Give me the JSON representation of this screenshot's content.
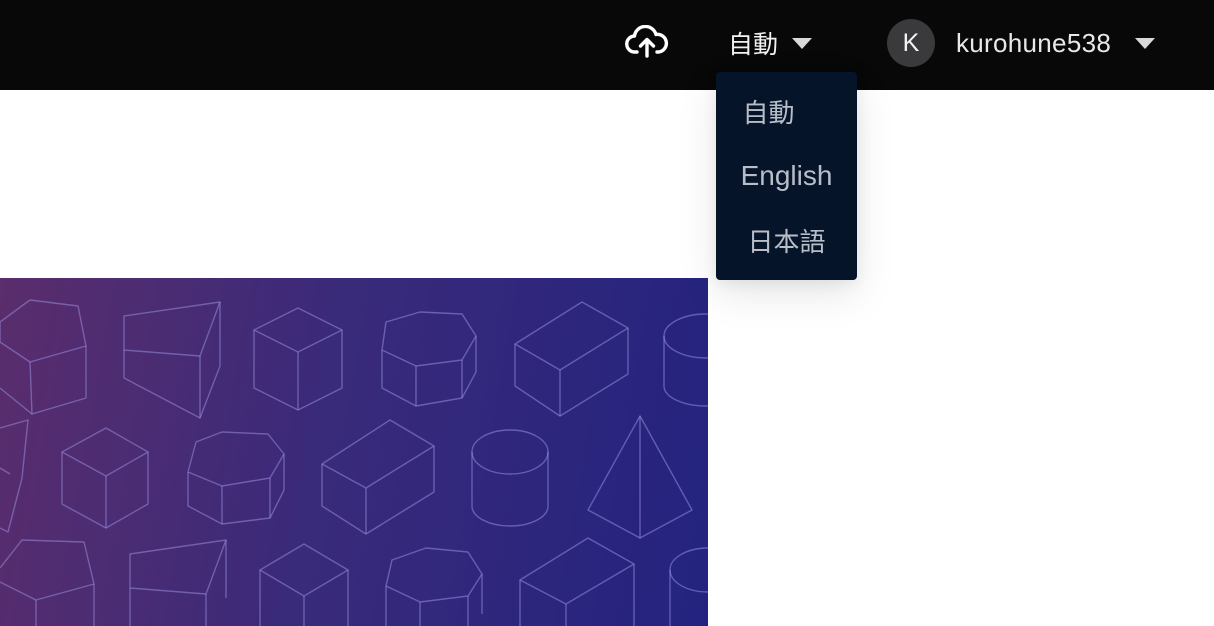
{
  "header": {
    "upload_icon": "cloud-upload-icon",
    "language_selector": {
      "current": "自動",
      "caret_icon": "triangle-down-icon"
    },
    "user_menu": {
      "avatar_initial": "K",
      "username": "kurohune538",
      "caret_icon": "triangle-down-icon"
    }
  },
  "language_dropdown": {
    "options": [
      "自動",
      "English",
      "日本語"
    ]
  },
  "banner": {
    "pattern": "wireframe-3d-shapes",
    "gradient": [
      "#5a2d6c",
      "#23237f"
    ]
  },
  "colors": {
    "topbar_bg": "#080808",
    "dropdown_bg": "#06142a",
    "dropdown_text": "#b8bec8",
    "header_text": "#f2f2f2"
  }
}
